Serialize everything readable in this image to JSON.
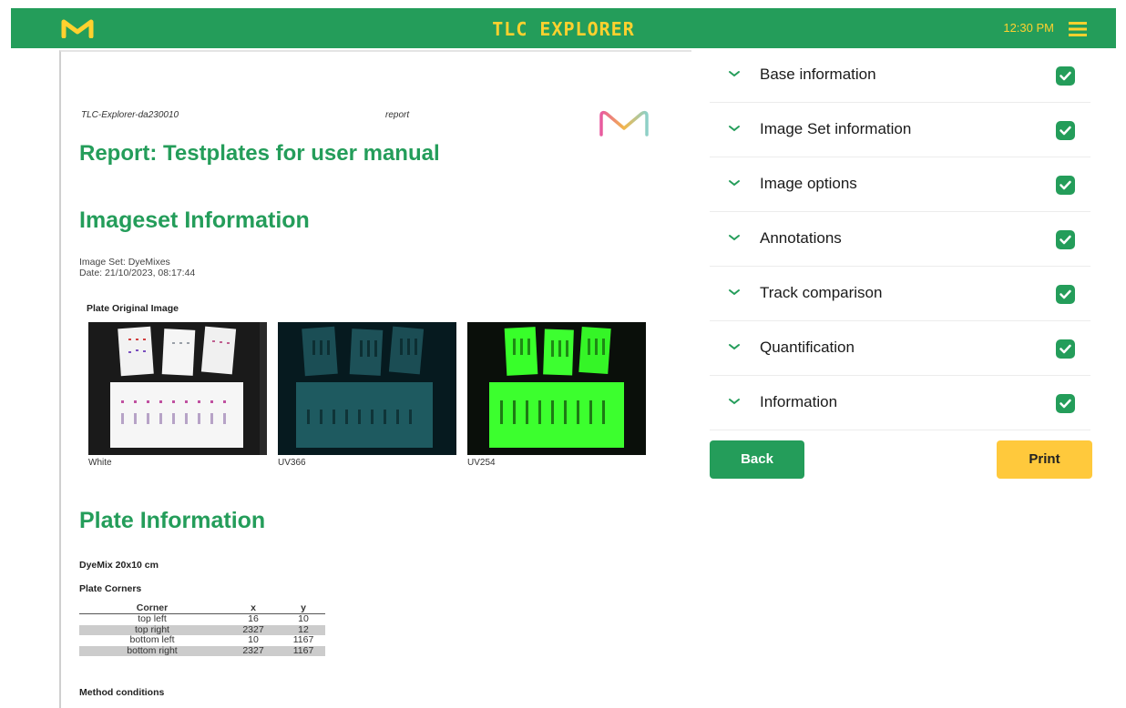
{
  "app": {
    "title": "TLC EXPLORER",
    "time": "12:30 PM",
    "brand_icon": "merck-m-logo",
    "menu_icon": "hamburger-menu-icon",
    "colors": {
      "primary": "#249d5a",
      "accent": "#ffd12e",
      "print_button": "#ffc93c"
    }
  },
  "report": {
    "doc_id": "TLC-Explorer-da230010",
    "doc_kind": "report",
    "title": "Report: Testplates for user manual",
    "imageset": {
      "heading": "Imageset Information",
      "image_set": "Image Set: DyeMixes",
      "date": "Date: 21/10/2023, 08:17:44",
      "plate_original_label": "Plate Original Image",
      "images": [
        {
          "caption": "White"
        },
        {
          "caption": "UV366"
        },
        {
          "caption": "UV254"
        }
      ]
    },
    "plate": {
      "heading": "Plate Information",
      "name": "DyeMix 20x10 cm",
      "corners_label": "Plate Corners",
      "columns": [
        "Corner",
        "x",
        "y"
      ],
      "rows": [
        {
          "corner": "top left",
          "x": "16",
          "y": "10"
        },
        {
          "corner": "top right",
          "x": "2327",
          "y": "12"
        },
        {
          "corner": "bottom left",
          "x": "10",
          "y": "1167"
        },
        {
          "corner": "bottom right",
          "x": "2327",
          "y": "1167"
        }
      ],
      "method_label": "Method conditions"
    }
  },
  "panel": {
    "sections": [
      {
        "label": "Base information",
        "checked": true
      },
      {
        "label": "Image Set information",
        "checked": true
      },
      {
        "label": "Image options",
        "checked": true
      },
      {
        "label": "Annotations",
        "checked": true
      },
      {
        "label": "Track comparison",
        "checked": true
      },
      {
        "label": "Quantification",
        "checked": true
      },
      {
        "label": "Information",
        "checked": true
      }
    ],
    "back_label": "Back",
    "print_label": "Print"
  }
}
